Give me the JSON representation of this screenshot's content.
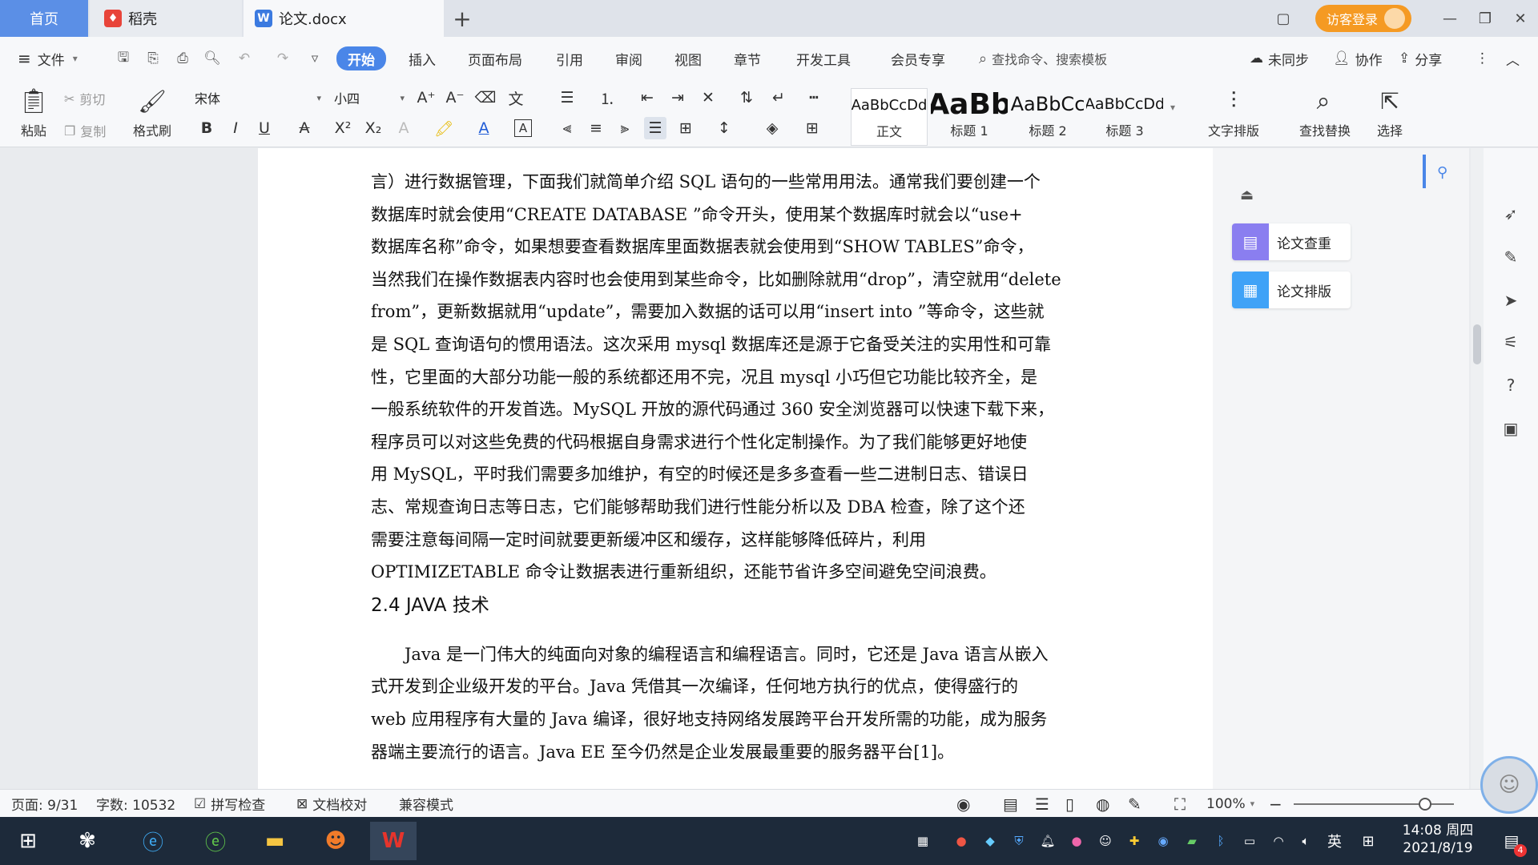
{
  "tabs": {
    "home": "首页",
    "daoke": "稻壳",
    "doc": "论文.docx",
    "add": "+"
  },
  "window": {
    "login": "访客登录",
    "minimize": "—",
    "restore": "❐",
    "close": "✕",
    "layout": "▢"
  },
  "menu": {
    "file": "文件",
    "items": [
      "开始",
      "插入",
      "页面布局",
      "引用",
      "审阅",
      "视图",
      "章节",
      "开发工具",
      "会员专享"
    ],
    "search": "查找命令、搜索模板",
    "unsynced": "未同步",
    "collab": "协作",
    "share": "分享"
  },
  "ribbon": {
    "paste": "粘贴",
    "cut": "剪切",
    "copy": "复制",
    "format_painter": "格式刷",
    "font_name": "宋体",
    "font_size": "小四",
    "styles": [
      {
        "sample": "AaBbCcDd",
        "name": "正文"
      },
      {
        "sample": "AaBb",
        "name": "标题 1"
      },
      {
        "sample": "AaBbCc",
        "name": "标题 2"
      },
      {
        "sample": "AaBbCcDd",
        "name": "标题 3"
      }
    ],
    "text_layout": "文字排版",
    "find_replace": "查找替换",
    "select": "选择"
  },
  "document": {
    "lines_para1": [
      "言）进行数据管理，下面我们就简单介绍 SQL 语句的一些常用用法。通常我们要创建一个",
      "数据库时就会使用“CREATE DATABASE ”命令开头，使用某个数据库时就会以“use+",
      "数据库名称”命令，如果想要查看数据库里面数据表就会使用到“SHOW TABLES”命令，",
      "当然我们在操作数据表内容时也会使用到某些命令，比如删除就用“drop”，清空就用“delete",
      "from”，更新数据就用“update”，需要加入数据的话可以用“insert into ”等命令，这些就",
      "是 SQL 查询语句的惯用语法。这次采用 mysql 数据库还是源于它备受关注的实用性和可靠",
      "性，它里面的大部分功能一般的系统都还用不完，况且 mysql 小巧但它功能比较齐全，是",
      "一般系统软件的开发首选。MySQL 开放的源代码通过 360 安全浏览器可以快速下载下来，",
      "程序员可以对这些免费的代码根据自身需求进行个性化定制操作。为了我们能够更好地使",
      "用 MySQL，平时我们需要多加维护，有空的时候还是多多查看一些二进制日志、错误日",
      "志、常规查询日志等日志，它们能够帮助我们进行性能分析以及 DBA 检查，除了这个还",
      "需要注意每间隔一定时间就要更新缓冲区和缓存，这样能够降低碎片，利用",
      "OPTIMIZETABLE 命令让数据表进行重新组织，还能节省许多空间避免空间浪费。"
    ],
    "heading": "2.4 JAVA 技术",
    "lines_para2": [
      "Java 是一门伟大的纯面向对象的编程语言和编程语言。同时，它还是 Java 语言从嵌入",
      "式开发到企业级开发的平台。Java 凭借其一次编译，任何地方执行的优点，使得盛行的",
      "web 应用程序有大量的 Java 编译，很好地支持网络发展跨平台开发所需的功能，成为服务",
      "器端主要流行的语言。Java EE 至今仍然是企业发展最重要的服务器平台[1]。"
    ]
  },
  "side_panel": {
    "check": "论文查重",
    "layout": "论文排版"
  },
  "status": {
    "page": "页面: 9/31",
    "words": "字数: 10532",
    "spell": "拼写检查",
    "proof": "文档校对",
    "compat": "兼容模式",
    "zoom": "100%",
    "zoom_fraction": 0.82
  },
  "taskbar": {
    "time": "14:08 周四",
    "date": "2021/8/19",
    "ime": "英",
    "notif_count": "4"
  },
  "colors": {
    "accent": "#4a86e8",
    "login": "#f59a23",
    "taskbar": "#1d2a3a",
    "panel_check": "#8a7ef0",
    "panel_layout": "#3fa2f7"
  }
}
